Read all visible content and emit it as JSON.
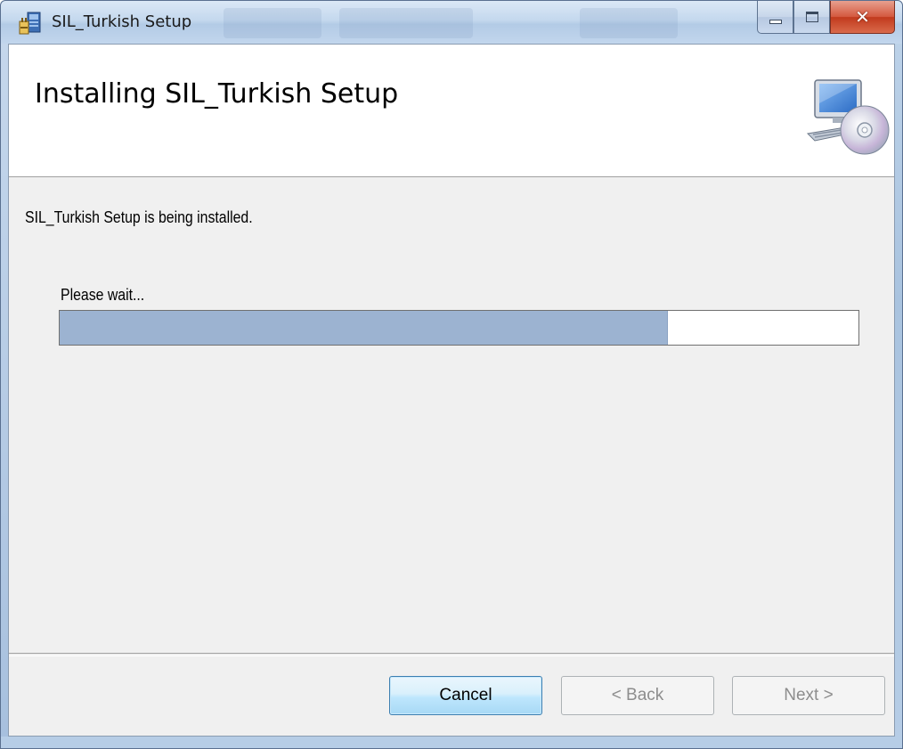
{
  "window": {
    "title": "SIL_Turkish Setup",
    "icon": "installer-icon",
    "caption_buttons": [
      "minimize-icon",
      "maximize-icon",
      "close-icon"
    ]
  },
  "banner": {
    "title": "Installing SIL_Turkish Setup",
    "icon": "computer-disc-icon"
  },
  "body": {
    "status": "SIL_Turkish Setup is being installed.",
    "wait_label": "Please wait...",
    "progress": 0.76
  },
  "buttons": {
    "cancel": "Cancel",
    "back": "< Back",
    "next": "Next >"
  },
  "colors": {
    "progress_fill": "#9cb3d1",
    "close_button": "#c13a1d",
    "focused_button_border": "#3c7fb1"
  }
}
